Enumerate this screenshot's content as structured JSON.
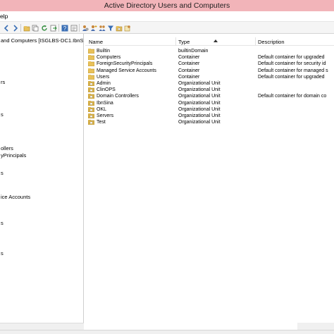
{
  "window": {
    "title": "Active Directory Users and Computers"
  },
  "menubar": {
    "items": [
      {
        "label": "elp"
      }
    ]
  },
  "toolbar": {
    "buttons": [
      "back-icon",
      "forward-icon",
      "folder-up-icon",
      "copy-icon",
      "refresh-icon",
      "export-icon",
      "help-icon",
      "properties-icon",
      "find-users-icon",
      "new-user-icon",
      "new-group-icon",
      "filter-icon",
      "new-ou-icon",
      "delegate-icon"
    ]
  },
  "tree": {
    "items": [
      {
        "label": "and Computers [ISGLBS-DC1.IbnS"
      },
      {
        "label": "rs"
      },
      {
        "label": "s"
      },
      {
        "label": "ollers"
      },
      {
        "label": "yPrincipals"
      },
      {
        "label": "s"
      },
      {
        "label": "ice Accounts"
      },
      {
        "label": "s"
      },
      {
        "label": "s"
      }
    ]
  },
  "list": {
    "columns": {
      "name": "Name",
      "type": "Type",
      "description": "Description"
    },
    "rows": [
      {
        "name": "Builtin",
        "type": "builtinDomain",
        "description": "",
        "icon": "builtin-folder-icon"
      },
      {
        "name": "Computers",
        "type": "Container",
        "description": "Default container for upgraded",
        "icon": "container-folder-icon"
      },
      {
        "name": "ForeignSecurityPrincipals",
        "type": "Container",
        "description": "Default container for security id",
        "icon": "container-folder-icon"
      },
      {
        "name": "Managed Service Accounts",
        "type": "Container",
        "description": "Default container for managed s",
        "icon": "container-folder-icon"
      },
      {
        "name": "Users",
        "type": "Container",
        "description": "Default container for upgraded",
        "icon": "container-folder-icon"
      },
      {
        "name": "Admin",
        "type": "Organizational Unit",
        "description": "",
        "icon": "ou-folder-icon"
      },
      {
        "name": "ClinOPS",
        "type": "Organizational Unit",
        "description": "",
        "icon": "ou-folder-icon"
      },
      {
        "name": "Domain Controllers",
        "type": "Organizational Unit",
        "description": "Default container for domain co",
        "icon": "ou-folder-icon"
      },
      {
        "name": "IbnSina",
        "type": "Organizational Unit",
        "description": "",
        "icon": "ou-folder-icon"
      },
      {
        "name": "OKL",
        "type": "Organizational Unit",
        "description": "",
        "icon": "ou-folder-icon"
      },
      {
        "name": "Servers",
        "type": "Organizational Unit",
        "description": "",
        "icon": "ou-folder-icon"
      },
      {
        "name": "Test",
        "type": "Organizational Unit",
        "description": "",
        "icon": "ou-folder-icon"
      }
    ]
  },
  "colors": {
    "titlebar": "#f2b4b9",
    "folder": "#e8c15a",
    "ou_folder": "#d9b24a"
  }
}
